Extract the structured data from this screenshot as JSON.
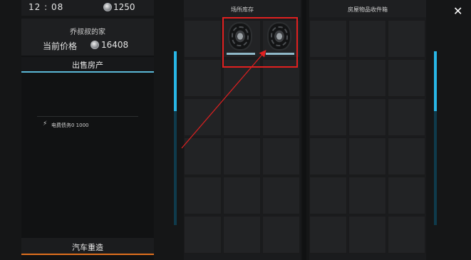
{
  "status": {
    "time": "12 : 08",
    "coins": "1250"
  },
  "house": {
    "name": "乔叔叔的家",
    "price_label": "当前价格",
    "price_value": "16408",
    "sell_label": "出售房产",
    "bill_icon": "lightning-icon",
    "bill_text": "电费债务0 1000",
    "rebuild_label": "汽车重造"
  },
  "inventory": {
    "site_title": "场所库存",
    "house_title": "房屋物品收件箱",
    "items": [
      {
        "icon": "tire-icon",
        "condition": 1.0
      },
      {
        "icon": "tire-icon",
        "condition": 1.0
      }
    ]
  },
  "close_icon": "close-icon",
  "colors": {
    "accent": "#28b6e6",
    "highlight": "#e02020",
    "rebuild_accent": "#e0701e"
  }
}
